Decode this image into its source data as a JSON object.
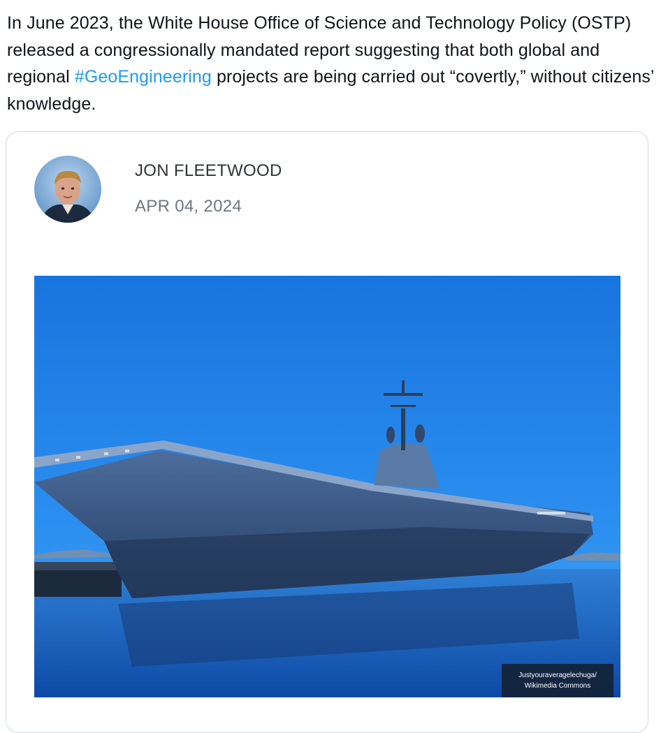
{
  "tweet": {
    "text_before": "In June 2023, the White House Office of Science and Technology Policy (OSTP) released a congressionally mandated report suggesting that both global and regional ",
    "hashtag": "#GeoEngineering",
    "text_after": " projects are being carried out “covertly,” without citizens’ knowledge."
  },
  "card": {
    "author_name": "JON FLEETWOOD",
    "date": "APR 04, 2024",
    "avatar_icon": "author-avatar",
    "image": {
      "subject": "aircraft-carrier-photo",
      "credit_line1": "Justyouraveragelechuga/",
      "credit_line2": "Wikimedia Commons"
    }
  },
  "colors": {
    "link": "#1d9bf0",
    "card_border": "#cfd9de",
    "sky": "#1e86e6",
    "ship": "#3a5680"
  }
}
